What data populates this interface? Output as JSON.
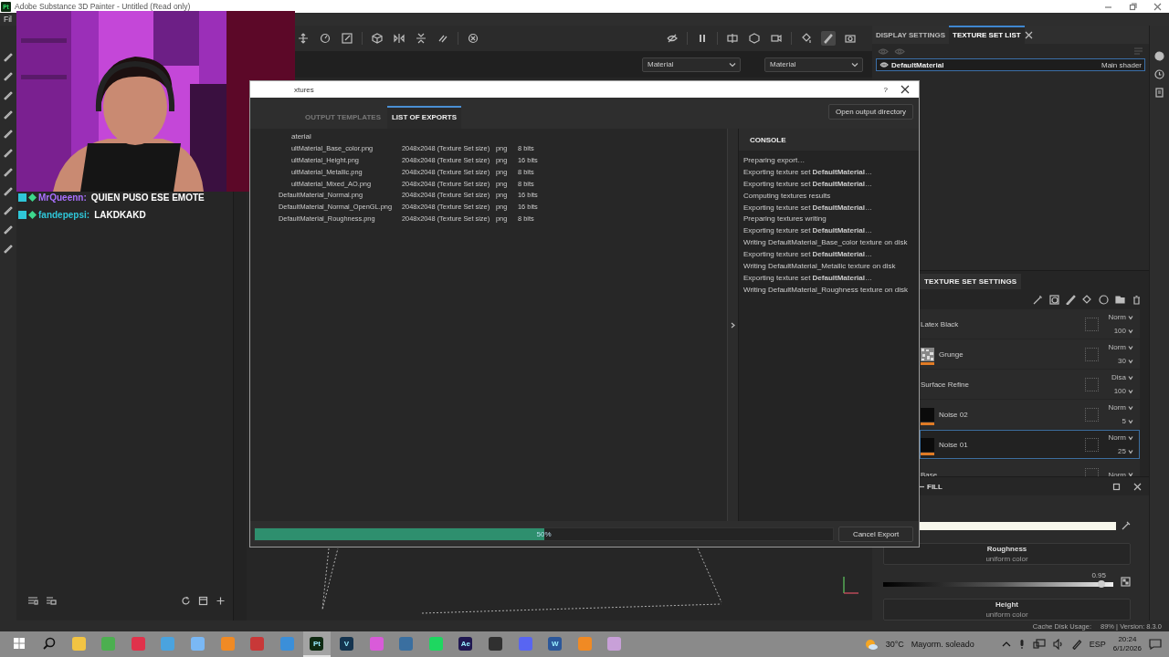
{
  "window": {
    "app_badge": "Pt",
    "title": "Adobe Substance 3D Painter - Untitled (Read only)"
  },
  "menu": [
    "Fil"
  ],
  "chat": [
    {
      "user": "MrQueenn:",
      "color": "#a970ff",
      "message": "QUIEN PUSO ESE EMOTE"
    },
    {
      "user": "fandepepsi:",
      "color": "#2fc6d8",
      "message": "LAKDKAKD"
    }
  ],
  "viewport": {
    "dropdowns": [
      "Material",
      "Material"
    ]
  },
  "texture_set_list": {
    "tabs": [
      {
        "label": "DISPLAY SETTINGS",
        "selected": false
      },
      {
        "label": "TEXTURE SET LIST",
        "selected": true
      }
    ],
    "items": [
      {
        "name": "DefaultMaterial",
        "shader": "Main shader",
        "selected": true
      }
    ]
  },
  "layers": {
    "tabs": [
      {
        "label": "TEXTURE SET SETTINGS",
        "selected": true
      }
    ],
    "rows": [
      {
        "name": "Latex Black",
        "blend": "Norm",
        "opacity": "100",
        "selected": false,
        "masked": false
      },
      {
        "name": "Grunge",
        "kind": "noise",
        "blend": "Norm",
        "opacity": "30",
        "selected": false,
        "masked": true
      },
      {
        "name": "Surface Refine",
        "blend": "Disa",
        "opacity": "100",
        "selected": false,
        "masked": false
      },
      {
        "name": "Noise 02",
        "kind": "dark",
        "blend": "Norm",
        "opacity": "5",
        "selected": false,
        "masked": true
      },
      {
        "name": "Noise 01",
        "kind": "dark",
        "blend": "Norm",
        "opacity": "25",
        "selected": true,
        "masked": true
      },
      {
        "name": "Base",
        "blend": "Norm",
        "selected": false,
        "masked": false
      }
    ]
  },
  "fill": {
    "title": "FILL",
    "color": "#f8f8ec",
    "channels": [
      {
        "name": "Roughness",
        "mode": "uniform color",
        "value": "0.95",
        "level": 0.95
      },
      {
        "name": "Height",
        "mode": "uniform color"
      }
    ]
  },
  "dialog": {
    "title": "xtures",
    "help": "?",
    "tabs": [
      {
        "label": "OUTPUT TEMPLATES",
        "selected": false
      },
      {
        "label": "LIST OF EXPORTS",
        "selected": true
      }
    ],
    "open_button": "Open output directory",
    "group": {
      "name": "aterial",
      "cut": true
    },
    "exports": [
      {
        "file": "ultMaterial_Base_color.png",
        "size": "2048x2048 (Texture Set size)",
        "format": "png",
        "depth": "8 bits",
        "cut": true
      },
      {
        "file": "ultMaterial_Height.png",
        "size": "2048x2048 (Texture Set size)",
        "format": "png",
        "depth": "16 bits",
        "cut": true
      },
      {
        "file": "ultMaterial_Metallic.png",
        "size": "2048x2048 (Texture Set size)",
        "format": "png",
        "depth": "8 bits",
        "cut": true
      },
      {
        "file": "ultMaterial_Mixed_AO.png",
        "size": "2048x2048 (Texture Set size)",
        "format": "png",
        "depth": "8 bits",
        "cut": true
      },
      {
        "file": "DefaultMaterial_Normal.png",
        "size": "2048x2048 (Texture Set size)",
        "format": "png",
        "depth": "16 bits",
        "cut": false
      },
      {
        "file": "DefaultMaterial_Normal_OpenGL.png",
        "size": "2048x2048 (Texture Set size)",
        "format": "png",
        "depth": "16 bits",
        "cut": false
      },
      {
        "file": "DefaultMaterial_Roughness.png",
        "size": "2048x2048 (Texture Set size)",
        "format": "png",
        "depth": "8 bits",
        "cut": false
      }
    ],
    "console": {
      "title": "CONSOLE",
      "lines": [
        "Preparing export…",
        "Exporting texture set **DefaultMaterial**…",
        "Exporting texture set **DefaultMaterial**…",
        "Computing textures results",
        "Exporting texture set **DefaultMaterial**…",
        "Preparing textures writing",
        "Exporting texture set **DefaultMaterial**…",
        "Writing DefaultMaterial_Base_color texture on disk",
        "Exporting texture set **DefaultMaterial**…",
        "Writing DefaultMaterial_Metallic texture on disk",
        "Exporting texture set **DefaultMaterial**…",
        "Writing DefaultMaterial_Roughness texture on disk"
      ]
    },
    "progress": {
      "level": 0.5,
      "label": "50%"
    },
    "cancel_button": "Cancel Export"
  },
  "status_bar": {
    "usage": "Cache Disk Usage:",
    "version": "89% | Version: 8.3.0"
  },
  "taskbar": {
    "apps": [
      {
        "color": "#f2c443",
        "selected": false
      },
      {
        "color": "#4caf50",
        "selected": false
      },
      {
        "color": "#e0324b",
        "selected": false
      },
      {
        "color": "#4aa3df",
        "selected": false
      },
      {
        "color": "#7ab8f5",
        "selected": false
      },
      {
        "color": "#f08a24",
        "selected": false
      },
      {
        "color": "#c83838",
        "selected": false
      },
      {
        "color": "#3b8fd9",
        "selected": false
      },
      {
        "color": "#0f2a12",
        "label": "Pt",
        "selected": true
      },
      {
        "color": "#15344f",
        "label": "V",
        "selected": false
      },
      {
        "color": "#d95bd9",
        "selected": false
      },
      {
        "color": "#3a6fa0",
        "selected": false
      },
      {
        "color": "#1ed760",
        "selected": false
      },
      {
        "color": "#1f1750",
        "label": "Ae",
        "selected": false
      },
      {
        "color": "#303030",
        "selected": false
      },
      {
        "color": "#5865f2",
        "selected": false
      },
      {
        "color": "#2b579a",
        "label": "W",
        "selected": false
      },
      {
        "color": "#f08a24",
        "selected": false
      },
      {
        "color": "#c8a0d8",
        "selected": false
      }
    ],
    "weather": {
      "temp": "30°C",
      "text": "Mayorm. soleado"
    },
    "language": "ESP",
    "time": "20:24",
    "date": "6/1/2026"
  }
}
